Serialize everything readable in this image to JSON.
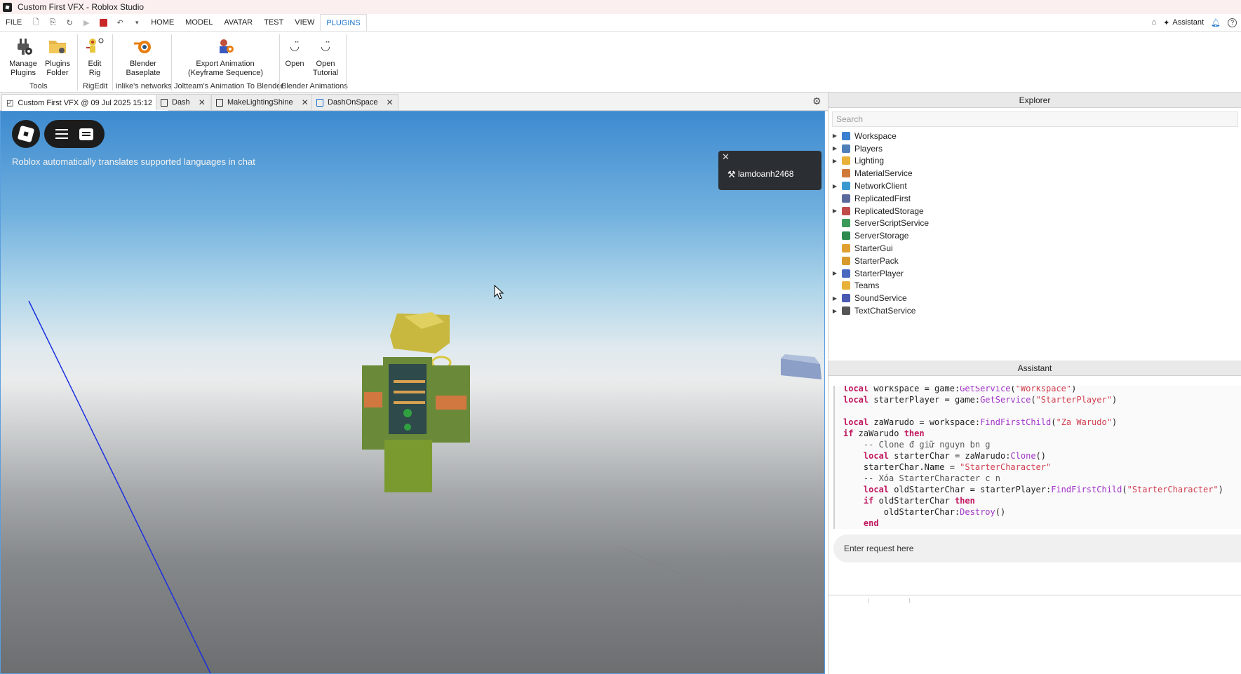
{
  "window": {
    "title": "Custom First VFX - Roblox Studio"
  },
  "menubar": {
    "items": [
      "FILE",
      "HOME",
      "MODEL",
      "AVATAR",
      "TEST",
      "VIEW",
      "PLUGINS"
    ],
    "active": "PLUGINS",
    "assistant_label": "Assistant"
  },
  "ribbon": {
    "buttons": {
      "manage_plugins": "Manage\nPlugins",
      "plugins_folder": "Plugins\nFolder",
      "edit_rig": "Edit\nRig",
      "blender_baseplate": "Blender\nBaseplate",
      "export_animation": "Export Animation\n(Keyframe Sequence)",
      "open": "Open",
      "open_tutorial": "Open\nTutorial"
    },
    "groups": {
      "tools": "Tools",
      "rigedit": "RigEdit",
      "inlike": "inlike's networks",
      "joltteam": "Joltteam's Animation To Blender",
      "blender_anim": "Blender Animations"
    }
  },
  "doc_tabs": [
    {
      "label": "Custom First VFX @ 09 Jul 2025 15:12"
    },
    {
      "label": "Dash"
    },
    {
      "label": "MakeLightingShine"
    },
    {
      "label": "DashOnSpace"
    }
  ],
  "viewport": {
    "translate_note": "Roblox automatically translates supported languages in chat",
    "player_name": "lamdoanh2468"
  },
  "explorer": {
    "title": "Explorer",
    "search_placeholder": "Search",
    "items": [
      {
        "label": "Workspace",
        "expandable": true,
        "color": "#3a7fd0"
      },
      {
        "label": "Players",
        "expandable": true,
        "color": "#4f7fb8"
      },
      {
        "label": "Lighting",
        "expandable": true,
        "color": "#e8b23a"
      },
      {
        "label": "MaterialService",
        "expandable": false,
        "color": "#d07a3a"
      },
      {
        "label": "NetworkClient",
        "expandable": true,
        "color": "#3a9ad0"
      },
      {
        "label": "ReplicatedFirst",
        "expandable": false,
        "color": "#5a6a9a"
      },
      {
        "label": "ReplicatedStorage",
        "expandable": true,
        "color": "#c04a4a"
      },
      {
        "label": "ServerScriptService",
        "expandable": false,
        "color": "#3a9a5a"
      },
      {
        "label": "ServerStorage",
        "expandable": false,
        "color": "#2e8a4e"
      },
      {
        "label": "StarterGui",
        "expandable": false,
        "color": "#e0a030"
      },
      {
        "label": "StarterPack",
        "expandable": false,
        "color": "#d89a2a"
      },
      {
        "label": "StarterPlayer",
        "expandable": true,
        "color": "#4a6ac0"
      },
      {
        "label": "Teams",
        "expandable": false,
        "color": "#e8b23a"
      },
      {
        "label": "SoundService",
        "expandable": true,
        "color": "#4a5ab0"
      },
      {
        "label": "TextChatService",
        "expandable": true,
        "color": "#555555"
      }
    ]
  },
  "assistant": {
    "title": "Assistant",
    "code_lines": [
      "local workspace = game:GetService(\"Workspace\")",
      "local starterPlayer = game:GetService(\"StarterPlayer\")",
      "",
      "local zaWarudo = workspace:FindFirstChild(\"Za Warudo\")",
      "if zaWarudo then",
      "    -- Clone đ\u0000\u0000 giữ nguy\u0000\u0000n b\u0000\u0000\u0000n g\u0000\u0000",
      "    local starterChar = zaWarudo:Clone()",
      "    starterChar.Name = \"StarterCharacter\"",
      "    -- Xóa StarterCharacter c\u0000\u0000 n\u0000\u0000\u0000",
      "    local oldStarterChar = starterPlayer:FindFirstChild(\"StarterCharacter\")",
      "    if oldStarterChar then",
      "        oldStarterChar:Destroy()",
      "    end"
    ],
    "request_placeholder": "Enter request here"
  }
}
